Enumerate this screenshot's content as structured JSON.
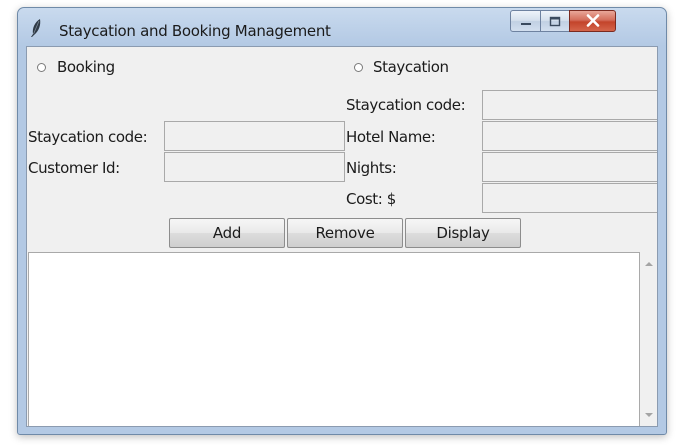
{
  "window": {
    "title": "Staycation and Booking Management"
  },
  "radios": {
    "booking": "Booking",
    "staycation": "Staycation",
    "selected": "none"
  },
  "booking_form": {
    "staycation_code_label": "Staycation code:",
    "customer_id_label": "Customer Id:",
    "staycation_code_value": "",
    "customer_id_value": ""
  },
  "staycation_form": {
    "staycation_code_label": "Staycation code:",
    "hotel_name_label": "Hotel Name:",
    "nights_label": "Nights:",
    "cost_label": "Cost: $",
    "staycation_code_value": "",
    "hotel_name_value": "",
    "nights_value": "",
    "cost_value": ""
  },
  "buttons": {
    "add": "Add",
    "remove": "Remove",
    "display": "Display"
  },
  "output": {
    "text": ""
  },
  "icons": {
    "app": "feather-icon",
    "minimize": "minimize-icon",
    "maximize": "maximize-icon",
    "close": "close-icon",
    "scroll_up": "scroll-up-arrow-icon",
    "scroll_down": "scroll-down-arrow-icon"
  },
  "colors": {
    "titlebar": "#bcd0e8",
    "close_button": "#c3442b",
    "client_bg": "#f0f0f0"
  }
}
